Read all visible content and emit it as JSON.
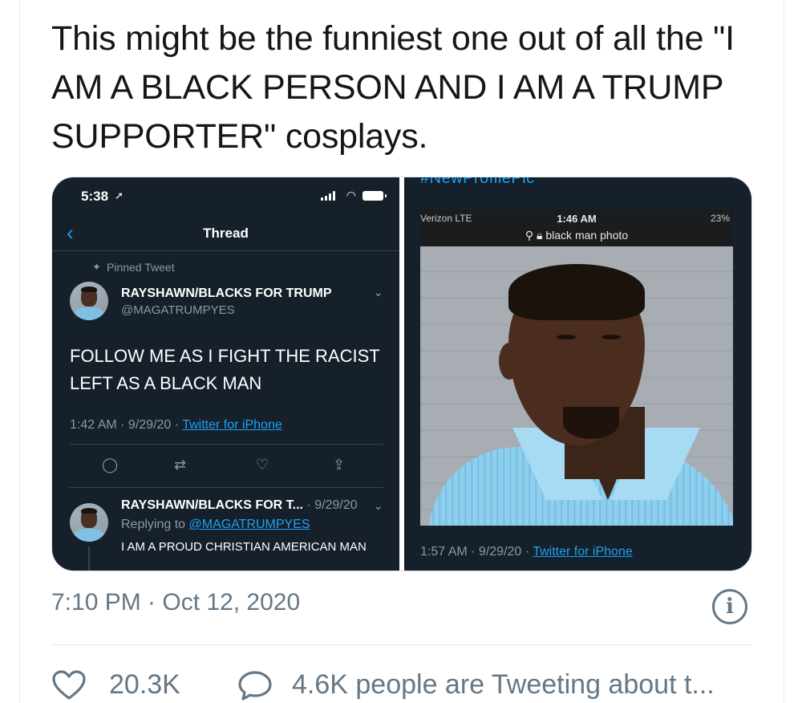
{
  "tweet": {
    "text": "This might be the funniest one out of all the \"I AM A BLACK PERSON AND I AM A TRUMP SUPPORTER\" cosplays.",
    "timestamp": "7:10 PM · Oct 12, 2020",
    "likes": "20.3K",
    "people_tweeting": "4.6K people are Tweeting about t..."
  },
  "left_screenshot": {
    "status_time": "5:38",
    "nav_title": "Thread",
    "pinned_label": "Pinned Tweet",
    "author_name": "RAYSHAWN/BLACKS FOR TRUMP",
    "author_handle": "@MAGATRUMPYES",
    "tweet_body": "FOLLOW ME AS I FIGHT THE RACIST LEFT AS A BLACK MAN",
    "meta_time": "1:42 AM · 9/29/20 · ",
    "meta_source": "Twitter for iPhone",
    "reply_author": "RAYSHAWN/BLACKS FOR T...",
    "reply_date": " · 9/29/20",
    "replying_to_label": "Replying to ",
    "replying_to_handle": "@MAGATRUMPYES",
    "reply_body": "I AM A PROUD CHRISTIAN AMERICAN MAN"
  },
  "right_screenshot": {
    "hashtag": "#NewProfilePic",
    "carrier": "Verizon  LTE",
    "phone_time": "1:46 AM",
    "battery": "23%",
    "url_text": "black man photo",
    "meta_time": "1:57 AM · 9/29/20 · ",
    "meta_source": "Twitter for iPhone"
  },
  "colors": {
    "link_blue": "#1da1f2",
    "dark_bg": "#15202b",
    "muted_gray": "#657786"
  }
}
